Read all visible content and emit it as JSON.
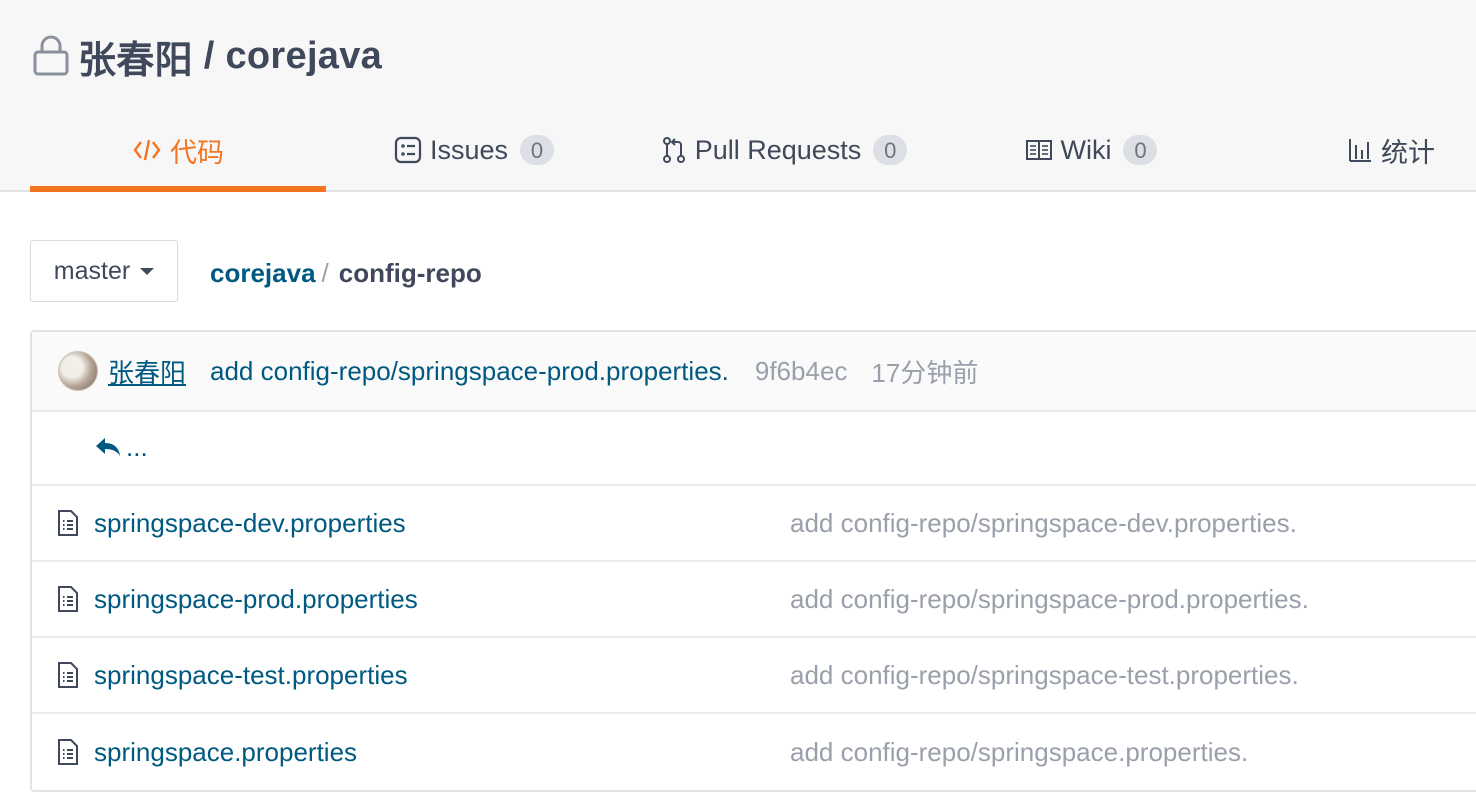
{
  "repo": {
    "owner": "张春阳",
    "separator": " / ",
    "name": "corejava"
  },
  "tabs": [
    {
      "label": "代码",
      "active": true
    },
    {
      "label": "Issues",
      "count": "0"
    },
    {
      "label": "Pull Requests",
      "count": "0"
    },
    {
      "label": "Wiki",
      "count": "0"
    },
    {
      "label": "统计"
    }
  ],
  "branch": {
    "selected": "master"
  },
  "breadcrumb": {
    "root": "corejava",
    "separator": "/",
    "current": "config-repo"
  },
  "latest_commit": {
    "author": "张春阳",
    "message": "add config-repo/springspace-prod.properties.",
    "sha": "9f6b4ec",
    "time": "17分钟前"
  },
  "back_row": {
    "label": "..."
  },
  "files": [
    {
      "name": "springspace-dev.properties",
      "commit": "add config-repo/springspace-dev.properties."
    },
    {
      "name": "springspace-prod.properties",
      "commit": "add config-repo/springspace-prod.properties."
    },
    {
      "name": "springspace-test.properties",
      "commit": "add config-repo/springspace-test.properties."
    },
    {
      "name": "springspace.properties",
      "commit": "add config-repo/springspace.properties."
    }
  ],
  "colors": {
    "accent": "#f37520",
    "link": "#005980",
    "muted": "#9aa0ab",
    "text": "#40485b"
  },
  "icons": [
    "lock-icon",
    "code-icon",
    "issues-icon",
    "pull-request-icon",
    "wiki-icon",
    "stats-icon",
    "caret-down-icon",
    "reply-back-icon",
    "file-icon"
  ]
}
